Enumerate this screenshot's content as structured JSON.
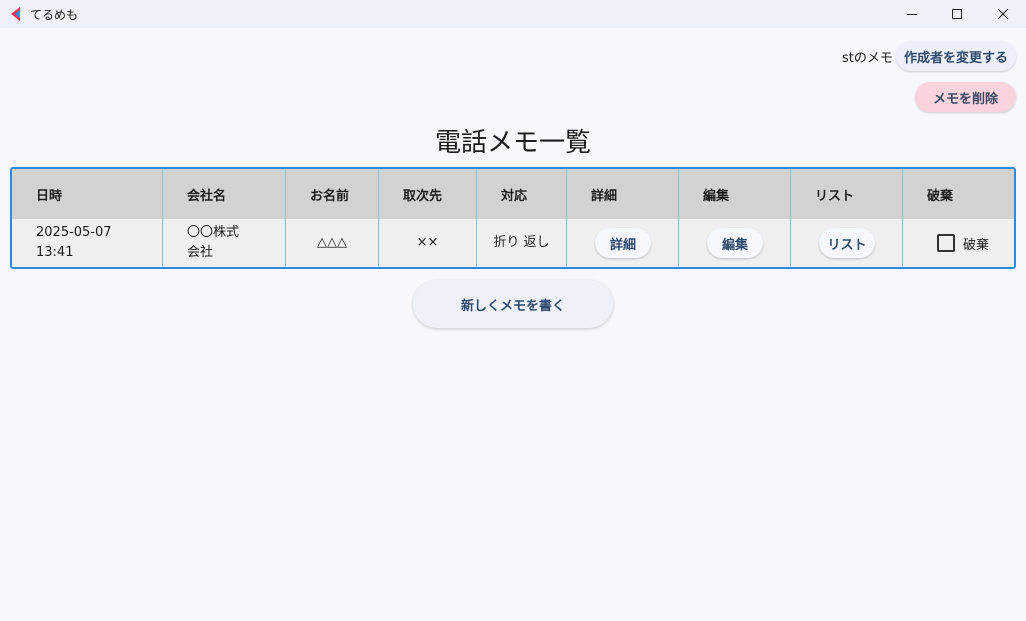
{
  "window": {
    "title": "てるめも",
    "icon": "app-logo-icon",
    "controls": [
      "minimize-icon",
      "maximize-icon",
      "close-icon"
    ]
  },
  "header": {
    "author_label": "stのメモ",
    "change_author_label": "作成者を変更する",
    "delete_memo_label": "メモを削除"
  },
  "page_title": "電話メモ一覧",
  "table": {
    "columns": [
      "日時",
      "会社名",
      "お名前",
      "取次先",
      "対応",
      "詳細",
      "編集",
      "リスト",
      "破棄"
    ],
    "rows": [
      {
        "datetime": "2025-05-07\n13:41",
        "company": "〇〇株式\n会社",
        "name": "△△△",
        "recipient": "××",
        "response": "折り\n返し",
        "details_button": "詳細",
        "edit_button": "編集",
        "list_button": "リスト",
        "discard_label": "破棄",
        "discard_checked": false
      }
    ]
  },
  "new_memo_label": "新しくメモを書く",
  "colors": {
    "background": "#f6f8fd",
    "table_border": "#2b8ae0",
    "header_bg": "#d2d2d2",
    "delete_button": "#fbd3dc",
    "button_text": "#2f4a6e"
  }
}
